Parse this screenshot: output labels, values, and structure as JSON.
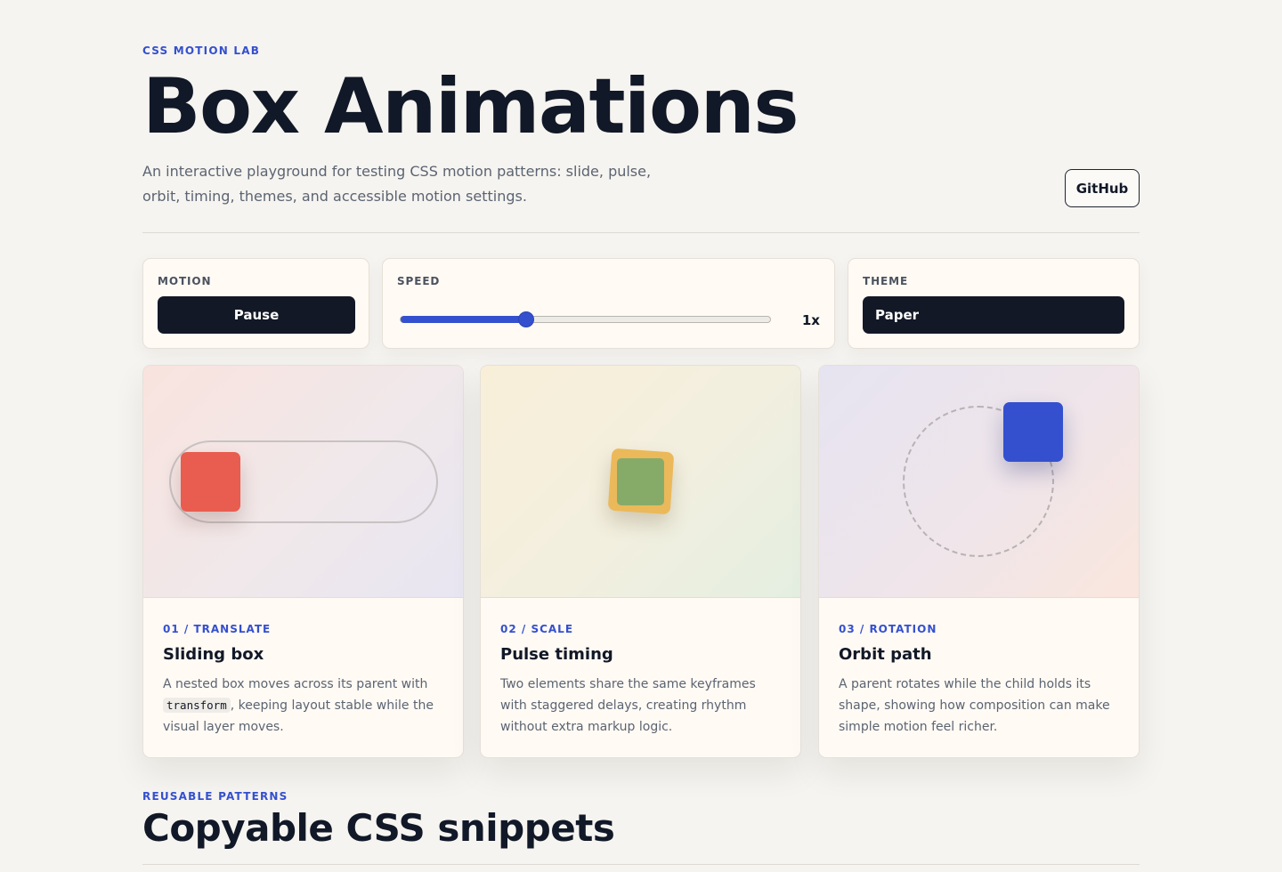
{
  "header": {
    "eyebrow": "CSS MOTION LAB",
    "title": "Box Animations",
    "subtitle": "An interactive playground for testing CSS motion patterns: slide, pulse, orbit, timing, themes, and accessible motion settings.",
    "github_label": "GitHub"
  },
  "controls": {
    "motion": {
      "label": "MOTION",
      "button_label": "Pause"
    },
    "speed": {
      "label": "SPEED",
      "value_label": "1x",
      "fraction": 0.34
    },
    "theme": {
      "label": "THEME",
      "selected": "Paper"
    }
  },
  "cards": [
    {
      "kicker": "01 / TRANSLATE",
      "title": "Sliding box",
      "desc_before": "A nested box moves across its parent with ",
      "desc_code": "transform",
      "desc_after": ", keeping layout stable while the visual layer moves.",
      "accent": "#e85d4f"
    },
    {
      "kicker": "02 / SCALE",
      "title": "Pulse timing",
      "desc": "Two elements share the same keyframes with staggered delays, creating rhythm without extra markup logic.",
      "accent": "#86ab69"
    },
    {
      "kicker": "03 / ROTATION",
      "title": "Orbit path",
      "desc": "A parent rotates while the child holds its shape, showing how composition can make simple motion feel richer.",
      "accent": "#3450cf"
    }
  ],
  "section": {
    "eyebrow": "REUSABLE PATTERNS",
    "title": "Copyable CSS snippets"
  },
  "colors": {
    "accent": "#3450cf",
    "background": "#f6f4f0",
    "dark": "#121826"
  }
}
